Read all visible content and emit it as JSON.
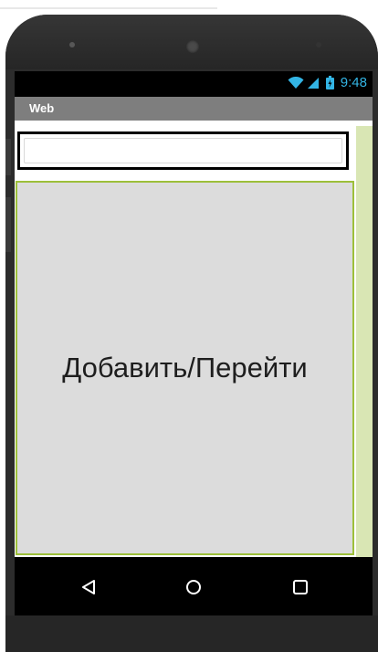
{
  "app": {
    "title": "Web"
  },
  "status_bar": {
    "time": "9:48",
    "icons": [
      "wifi-icon",
      "signal-icon",
      "battery-icon"
    ],
    "accent_color": "#33b5e5"
  },
  "screen": {
    "text_input": {
      "value": "",
      "placeholder": ""
    },
    "main_button": {
      "label": "Добавить/Перейти",
      "background": "#dcdcdc",
      "border_color": "#9dbf3a"
    }
  },
  "nav_bar": {
    "buttons": [
      "back-icon",
      "home-icon",
      "recents-icon"
    ]
  }
}
